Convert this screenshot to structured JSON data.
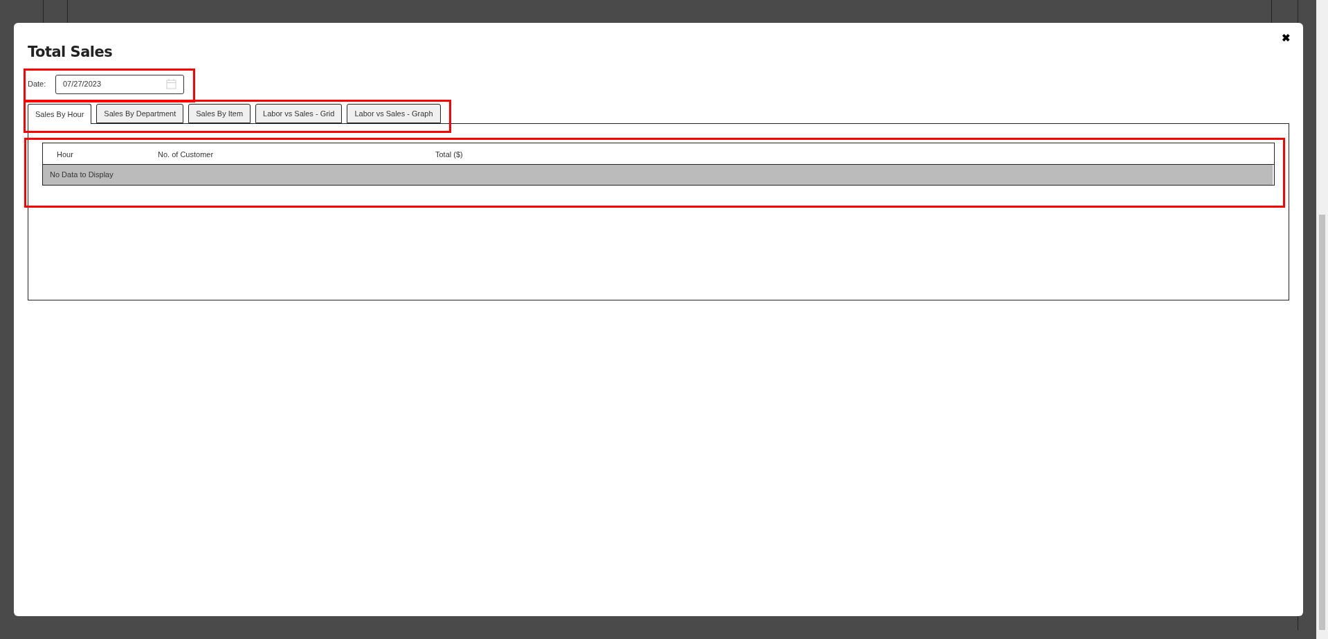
{
  "dialog": {
    "title": "Total Sales",
    "close": "✖"
  },
  "date_field": {
    "label": "Date:",
    "value": "07/27/2023"
  },
  "tabs": [
    {
      "label": "Sales By Hour",
      "selected": true
    },
    {
      "label": "Sales By Department",
      "selected": false
    },
    {
      "label": "Sales By Item",
      "selected": false
    },
    {
      "label": "Labor vs Sales - Grid",
      "selected": false
    },
    {
      "label": "Labor vs Sales - Graph",
      "selected": false
    }
  ],
  "table": {
    "columns": [
      "Hour",
      "No. of Customer",
      "Total ($)"
    ],
    "empty_message": "No Data to Display"
  }
}
